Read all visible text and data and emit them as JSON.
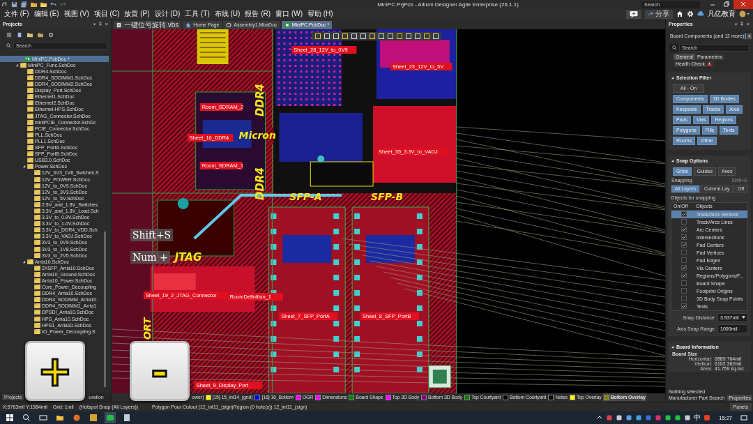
{
  "title_bar": {
    "title": "MiniPC.PrjPcb - Altium Designer Agile Enterprise (26.1.1)",
    "search": {
      "placeholder": "Search"
    }
  },
  "menu": [
    "文件 (F)",
    "编辑 (E)",
    "视图 (V)",
    "项目 (C)",
    "放置 (P)",
    "设计 (D)",
    "工具 (T)",
    "布线 (U)",
    "报告 (R)",
    "窗口 (W)",
    "帮助 (H)"
  ],
  "header_actions": {
    "share": "分享",
    "account": "凡亿教育"
  },
  "projects_panel": {
    "title": "Projects",
    "search": {
      "placeholder": "Search"
    },
    "tree": [
      {
        "label": "MiniPC.PcbDoc *",
        "kind": "pcb",
        "selected": true,
        "expanded": false
      },
      {
        "label": "MiniPC_Func.SchDoc",
        "kind": "sch",
        "selected": false,
        "expanded": true,
        "children": [
          {
            "label": "DDR4.SchDoc",
            "kind": "sch",
            "selected": false,
            "expanded": false
          },
          {
            "label": "DDR4_SODIMM1.SchDoc",
            "kind": "sch",
            "selected": false,
            "expanded": false
          },
          {
            "label": "DDR4_SODIMM2.SchDoc",
            "kind": "sch",
            "selected": false,
            "expanded": false
          },
          {
            "label": "Display_Port.SchDoc",
            "kind": "sch",
            "selected": false,
            "expanded": false
          },
          {
            "label": "Ethernet1.SchDoc",
            "kind": "sch",
            "selected": false,
            "expanded": false
          },
          {
            "label": "Ethernet2.SchDoc",
            "kind": "sch",
            "selected": false,
            "expanded": false
          },
          {
            "label": "Ethernet-HPS.SchDoc",
            "kind": "sch",
            "selected": false,
            "expanded": false
          },
          {
            "label": "JTAG_Connector.SchDoc",
            "kind": "sch",
            "selected": false,
            "expanded": false
          },
          {
            "label": "miniPCIE_Connector.SchDc",
            "kind": "sch",
            "selected": false,
            "expanded": false
          },
          {
            "label": "PCIE_Connector.SchDoc",
            "kind": "sch",
            "selected": false,
            "expanded": false
          },
          {
            "label": "PLL.SchDoc",
            "kind": "sch",
            "selected": false,
            "expanded": false
          },
          {
            "label": "PLL1.SchDoc",
            "kind": "sch",
            "selected": false,
            "expanded": false
          },
          {
            "label": "SFP_PortA.SchDoc",
            "kind": "sch",
            "selected": false,
            "expanded": false
          },
          {
            "label": "SFP_PortB.SchDoc",
            "kind": "sch",
            "selected": false,
            "expanded": false
          },
          {
            "label": "USB3.0.SchDoc",
            "kind": "sch",
            "selected": false,
            "expanded": false
          },
          {
            "label": "Power.SchDoc",
            "kind": "sch",
            "selected": false,
            "expanded": true,
            "children": [
              {
                "label": "12V_3V3_1V8_Swiches.S",
                "kind": "sch",
                "selected": false,
                "expanded": false
              },
              {
                "label": "12V_POWER.SchDoc",
                "kind": "sch",
                "selected": false,
                "expanded": false
              },
              {
                "label": "12V_to_0V9.SchDoc",
                "kind": "sch",
                "selected": false,
                "expanded": false
              },
              {
                "label": "12V_to_3V3.SchDoc",
                "kind": "sch",
                "selected": false,
                "expanded": false
              },
              {
                "label": "12V_to_5V.SchDoc",
                "kind": "sch",
                "selected": false,
                "expanded": false
              },
              {
                "label": "2.5V_and_1.8V_Switches",
                "kind": "sch",
                "selected": false,
                "expanded": false
              },
              {
                "label": "3.3V_and_1.8V_Load.Sch",
                "kind": "sch",
                "selected": false,
                "expanded": false
              },
              {
                "label": "3.3V_to_0.9V.SchDoc",
                "kind": "sch",
                "selected": false,
                "expanded": false
              },
              {
                "label": "3.3V_to_1.0V.SchDoc",
                "kind": "sch",
                "selected": false,
                "expanded": false
              },
              {
                "label": "3.3V_to_DDR4_VDD.Sch",
                "kind": "sch",
                "selected": false,
                "expanded": false
              },
              {
                "label": "3.3V_to_VADJ.SchDoc",
                "kind": "sch",
                "selected": false,
                "expanded": false
              },
              {
                "label": "3V3_to_0V9.SchDoc",
                "kind": "sch",
                "selected": false,
                "expanded": false
              },
              {
                "label": "3V3_to_1V8.SchDoc",
                "kind": "sch",
                "selected": false,
                "expanded": false
              },
              {
                "label": "3V3_to_2V5.SchDoc",
                "kind": "sch",
                "selected": false,
                "expanded": false
              }
            ]
          },
          {
            "label": "Arria10.SchDoc",
            "kind": "sch",
            "selected": false,
            "expanded": true,
            "children": [
              {
                "label": "2XSFP_Arria10.SchDoc",
                "kind": "sch",
                "selected": false,
                "expanded": false
              },
              {
                "label": "Arria10_Ground.SchDoc",
                "kind": "sch",
                "selected": false,
                "expanded": false
              },
              {
                "label": "Arria10_Power.SchDoc",
                "kind": "sch",
                "selected": false,
                "expanded": false
              },
              {
                "label": "Core_Power_Decoupling",
                "kind": "sch",
                "selected": false,
                "expanded": false
              },
              {
                "label": "DDR4_Arria10.SchDoc",
                "kind": "sch",
                "selected": false,
                "expanded": false
              },
              {
                "label": "DDR4_SODIMM_Arria10.",
                "kind": "sch",
                "selected": false,
                "expanded": false
              },
              {
                "label": "DDR4_SODIMM1_Arria1",
                "kind": "sch",
                "selected": false,
                "expanded": false
              },
              {
                "label": "DPSDI_Arria10.SchDoc",
                "kind": "sch",
                "selected": false,
                "expanded": false
              },
              {
                "label": "HPS_Arria10.SchDoc",
                "kind": "sch",
                "selected": false,
                "expanded": false
              },
              {
                "label": "HPS1_Arria10.SchDoc",
                "kind": "sch",
                "selected": false,
                "expanded": false
              },
              {
                "label": "IO_Power_Decoupling.S",
                "kind": "sch",
                "selected": false,
                "expanded": false
              }
            ]
          }
        ]
      }
    ],
    "tabs": [
      {
        "label": "Projects",
        "selected": true
      },
      {
        "label": "uration",
        "selected": false
      }
    ]
  },
  "document_tabs": [
    {
      "label": "一键位号旋转.vbs",
      "kind": "script",
      "selected": false
    },
    {
      "label": "Home Page",
      "kind": "home",
      "selected": false
    },
    {
      "label": "Assembly1.MbaDoc",
      "kind": "assembly",
      "selected": false
    },
    {
      "label": "MiniPC.PcbDoc *",
      "kind": "pcb",
      "selected": true
    }
  ],
  "pcb": {
    "labels": [
      {
        "text": "DDR4",
        "kind": "silk"
      },
      {
        "text": "DDR4",
        "kind": "silk"
      },
      {
        "text": "Micron",
        "kind": "silk"
      },
      {
        "text": "SFP-A",
        "kind": "silk"
      },
      {
        "text": "SFP-B",
        "kind": "silk"
      },
      {
        "text": "JTAG",
        "kind": "silk"
      },
      {
        "text": "ORT",
        "kind": "silk"
      },
      {
        "text": "Sheet_28_12V_to_0V9",
        "kind": "sheet"
      },
      {
        "text": "Sheet_23_12V_to_5V",
        "kind": "sheet"
      },
      {
        "text": "Room_SDRAM_2",
        "kind": "sheet"
      },
      {
        "text": "Sheet_16_DDR4",
        "kind": "sheet"
      },
      {
        "text": "Room_SDRAM_1",
        "kind": "sheet"
      },
      {
        "text": "Sheet_35_3.3V_to_VADJ",
        "kind": "sheet"
      },
      {
        "text": "Sheet_19_2_JTAG_Connector",
        "kind": "sheet"
      },
      {
        "text": "RoomDefinition_1",
        "kind": "sheet"
      },
      {
        "text": "Sheet_7_SFP_PortA",
        "kind": "sheet"
      },
      {
        "text": "Sheet_8_SFP_PortB",
        "kind": "sheet"
      },
      {
        "text": "Sheet_9_Display_Port",
        "kind": "sheet"
      }
    ],
    "key_overlays": [
      "Shift+S",
      "Num +"
    ]
  },
  "key_caps": [
    "+",
    "-"
  ],
  "layer_tab_fragment": "ower)",
  "layer_tabs": [
    {
      "label": "[15] 15_int14_(gnd)",
      "color": "#ffff00",
      "selected": false
    },
    {
      "label": "[16] 16_Bottom",
      "color": "#0000ff",
      "selected": false
    },
    {
      "label": "OGR",
      "color": "#ff00ff",
      "selected": false
    },
    {
      "label": "Dimensions",
      "color": "#ff00ff",
      "selected": false
    },
    {
      "label": "Board Shape",
      "color": "#008000",
      "selected": false
    },
    {
      "label": "Top 3D Body",
      "color": "#ff00ff",
      "selected": false
    },
    {
      "label": "Bottom 3D Body",
      "color": "#800080",
      "selected": false
    },
    {
      "label": "Top Courtyard",
      "color": "#008000",
      "selected": false
    },
    {
      "label": "Bottom Courtyard",
      "color": "#000000",
      "selected": false
    },
    {
      "label": "Notes",
      "color": "#000000",
      "selected": false
    },
    {
      "label": "Top Overlay",
      "color": "#ffff00",
      "selected": false
    },
    {
      "label": "Bottom Overlay",
      "color": "#808000",
      "selected": true
    }
  ],
  "status_bar": {
    "coordinates": "X:5763mil Y:1984mil",
    "grid": "Grid: 1mil",
    "snap": "(Hotspot Snap (All Layers))",
    "message": "Polygon Pour Cutout (12_int11_(sign)Region (0 hole(s)) 12_int11_(sign)",
    "panels": "Panels"
  },
  "properties_panel": {
    "title": "Properties",
    "filter": "Board  Components (and 12 more)",
    "search": {
      "placeholder": "Search"
    },
    "tabs": [
      {
        "label": "General",
        "selected": true
      },
      {
        "label": "Parameters",
        "selected": false
      },
      {
        "label": "Health Check",
        "selected": false
      }
    ],
    "selection_filter": {
      "title": "Selection Filter",
      "buttons": [
        {
          "label": "All - On",
          "on": false
        },
        {
          "label": "Components",
          "on": true
        },
        {
          "label": "3D Bodies",
          "on": true
        },
        {
          "label": "Keepouts",
          "on": true
        },
        {
          "label": "Tracks",
          "on": true
        },
        {
          "label": "Arcs",
          "on": true
        },
        {
          "label": "Pads",
          "on": true
        },
        {
          "label": "Vias",
          "on": true
        },
        {
          "label": "Regions",
          "on": true
        },
        {
          "label": "Polygons",
          "on": true
        },
        {
          "label": "Fills",
          "on": true
        },
        {
          "label": "Texts",
          "on": true
        },
        {
          "label": "Rooms",
          "on": true
        },
        {
          "label": "Other",
          "on": true
        }
      ]
    },
    "snap_options": {
      "title": "Snap Options",
      "modes": [
        {
          "label": "Grids",
          "on": true
        },
        {
          "label": "Guides",
          "on": false
        },
        {
          "label": "Axes",
          "on": false
        }
      ],
      "snapping_label": "Snapping",
      "snapping_shortcut": "Shift+E",
      "snapping": [
        {
          "label": "All Layers",
          "selected": true
        },
        {
          "label": "Current Lay",
          "selected": false
        },
        {
          "label": "Off",
          "selected": false
        }
      ],
      "objects_label": "Objects for snapping",
      "columns": [
        "On/Off",
        "Objects"
      ],
      "objects": [
        {
          "label": "Track/Arcs Vertices",
          "checked": true,
          "selected": true
        },
        {
          "label": "Track/Arcs Lines",
          "checked": false,
          "selected": false
        },
        {
          "label": "Arc Centers",
          "checked": true,
          "selected": false
        },
        {
          "label": "Intersections",
          "checked": true,
          "selected": false
        },
        {
          "label": "Pad Centers",
          "checked": true,
          "selected": false
        },
        {
          "label": "Pad Vertices",
          "checked": false,
          "selected": false
        },
        {
          "label": "Pad Edges",
          "checked": false,
          "selected": false
        },
        {
          "label": "Via Centers",
          "checked": true,
          "selected": false
        },
        {
          "label": "Regions/Polygons/F...",
          "checked": true,
          "selected": false
        },
        {
          "label": "Board Shape",
          "checked": false,
          "selected": false
        },
        {
          "label": "Footprint Origins",
          "checked": false,
          "selected": false
        },
        {
          "label": "3D Body Snap Points",
          "checked": false,
          "selected": false
        },
        {
          "label": "Texts",
          "checked": true,
          "selected": false
        }
      ],
      "snap_distance_label": "Snap Distance",
      "snap_distance": "3.937mil",
      "axis_range_label": "Axis Snap Range",
      "axis_range": "1000mil"
    },
    "board_information": {
      "title": "Board Information",
      "subtitle": "Board Size",
      "rows": [
        {
          "label": "Horizontal:",
          "value": "6889.764mil"
        },
        {
          "label": "Vertical:",
          "value": "6102.362mil"
        },
        {
          "label": "Area:",
          "value": "41.759 sq.inc"
        }
      ]
    },
    "selection_status": "Nothing selected",
    "bottom_tabs": [
      {
        "label": "Manufacturer Part Search",
        "selected": false
      },
      {
        "label": "Properties",
        "selected": true
      }
    ]
  },
  "taskbar": {
    "ime": "中",
    "time": "15:27"
  }
}
